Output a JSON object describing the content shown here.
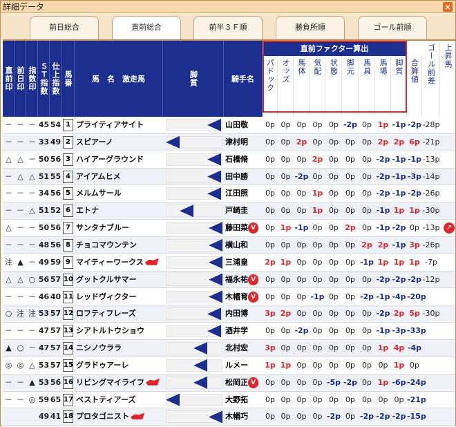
{
  "window": {
    "title": "詳細データ",
    "close_label": "×"
  },
  "tabs": [
    {
      "label": "前日総合",
      "active": false
    },
    {
      "label": "直前総合",
      "active": true
    },
    {
      "label": "前半３Ｆ順",
      "active": false
    },
    {
      "label": "勝負所順",
      "active": false
    },
    {
      "label": "ゴール前順",
      "active": false
    }
  ],
  "columns": {
    "chokuzen": "直前印",
    "zenjitsu": "前日印",
    "shisu": "指数印",
    "st": "ＳＴ指数",
    "shiage": "仕上指数",
    "umaban": "馬番",
    "horse": "馬　名　激走馬",
    "kyakushitsu": "脚質",
    "jockey": "騎手名",
    "factor_title": "直前ファクター算出",
    "factors": [
      "パドック",
      "オッズ",
      "馬体",
      "気配",
      "状態",
      "脚元",
      "馬具",
      "馬場",
      "脚質"
    ],
    "gosan": "合算値",
    "goal": "ゴール前差",
    "rise": "上昇馬"
  },
  "colors": {
    "header": "#1c2e8e",
    "accent": "#e0262c",
    "tab_bg": "#f5e4c8"
  },
  "rows": [
    {
      "chokuzen": "－",
      "zenjitsu": "－",
      "shisu": "－",
      "st": "45",
      "shiage": "54",
      "umaban": "1",
      "horse": "プライティアサイト",
      "hat": false,
      "leg": 3,
      "jockey": "山田敬",
      "v": false,
      "factors": [
        "0p",
        "0p",
        "0p",
        "0p",
        "0p",
        "-2p",
        "0p",
        "1p",
        "-1p"
      ],
      "gosan": "-2p",
      "goal": "-28p",
      "rise": false
    },
    {
      "chokuzen": "－",
      "zenjitsu": "－",
      "shisu": "－",
      "st": "33",
      "shiage": "49",
      "umaban": "2",
      "horse": "スピアーノ",
      "hat": false,
      "leg": 0,
      "jockey": "津村明",
      "v": false,
      "factors": [
        "0p",
        "0p",
        "2p",
        "0p",
        "0p",
        "0p",
        "0p",
        "2p",
        "2p"
      ],
      "gosan": "6p",
      "goal": "-21p",
      "rise": false
    },
    {
      "chokuzen": "△",
      "zenjitsu": "△",
      "shisu": "－",
      "st": "50",
      "shiage": "56",
      "umaban": "3",
      "horse": "ハイアーグラウンド",
      "hat": false,
      "leg": 3,
      "jockey": "石橋脩",
      "v": false,
      "factors": [
        "0p",
        "0p",
        "0p",
        "2p",
        "0p",
        "0p",
        "0p",
        "-2p",
        "-1p"
      ],
      "gosan": "-1p",
      "goal": "-13p",
      "rise": false
    },
    {
      "chokuzen": "－",
      "zenjitsu": "△",
      "shisu": "△",
      "st": "51",
      "shiage": "55",
      "umaban": "4",
      "horse": "アイアムヒメ",
      "hat": false,
      "leg": 3,
      "jockey": "田中勝",
      "v": false,
      "factors": [
        "0p",
        "0p",
        "-2p",
        "0p",
        "0p",
        "0p",
        "0p",
        "-2p",
        "-1p"
      ],
      "gosan": "-3p",
      "goal": "-14p",
      "rise": false
    },
    {
      "chokuzen": "－",
      "zenjitsu": "－",
      "shisu": "－",
      "st": "34",
      "shiage": "56",
      "umaban": "5",
      "horse": "メルムサール",
      "hat": false,
      "leg": 3,
      "jockey": "江田照",
      "v": false,
      "factors": [
        "0p",
        "0p",
        "0p",
        "1p",
        "0p",
        "0p",
        "0p",
        "-2p",
        "-1p"
      ],
      "gosan": "-2p",
      "goal": "-26p",
      "rise": false
    },
    {
      "chokuzen": "－",
      "zenjitsu": "－",
      "shisu": "△",
      "st": "51",
      "shiage": "52",
      "umaban": "6",
      "horse": "エトナ",
      "hat": false,
      "leg": 1,
      "jockey": "戸崎圭",
      "v": false,
      "factors": [
        "0p",
        "0p",
        "0p",
        "1p",
        "0p",
        "0p",
        "0p",
        "-1p",
        "1p"
      ],
      "gosan": "1p",
      "goal": "-30p",
      "rise": false
    },
    {
      "chokuzen": "△",
      "zenjitsu": "－",
      "shisu": "－",
      "st": "50",
      "shiage": "56",
      "umaban": "7",
      "horse": "サンタナブルー",
      "hat": false,
      "leg": 4,
      "jockey": "藤田菜",
      "v": true,
      "factors": [
        "0p",
        "1p",
        "-1p",
        "0p",
        "0p",
        "2p",
        "0p",
        "-1p",
        "-2p"
      ],
      "gosan": "0p",
      "goal": "-13p",
      "rise": true
    },
    {
      "chokuzen": "－",
      "zenjitsu": "－",
      "shisu": "－",
      "st": "48",
      "shiage": "56",
      "umaban": "8",
      "horse": "チョコマウンテン",
      "hat": false,
      "leg": 4,
      "jockey": "横山和",
      "v": false,
      "factors": [
        "0p",
        "0p",
        "0p",
        "0p",
        "0p",
        "0p",
        "2p",
        "2p",
        "-1p"
      ],
      "gosan": "3p",
      "goal": "-26p",
      "rise": false
    },
    {
      "chokuzen": "注",
      "zenjitsu": "▲",
      "shisu": "－",
      "st": "49",
      "shiage": "59",
      "umaban": "9",
      "horse": "マイティーワークス",
      "hat": true,
      "leg": 4,
      "jockey": "三浦皇",
      "v": false,
      "factors": [
        "2p",
        "1p",
        "0p",
        "0p",
        "0p",
        "0p",
        "-1p",
        "1p",
        "1p"
      ],
      "gosan": "1p",
      "goal": "-7p",
      "rise": false
    },
    {
      "chokuzen": "△",
      "zenjitsu": "△",
      "shisu": "○",
      "st": "56",
      "shiage": "57",
      "umaban": "10",
      "horse": "グットクルサマー",
      "hat": false,
      "leg": 4,
      "jockey": "福永祐",
      "v": true,
      "factors": [
        "0p",
        "0p",
        "0p",
        "0p",
        "0p",
        "0p",
        "0p",
        "-2p",
        "-2p"
      ],
      "gosan": "-2p",
      "goal": "-12p",
      "rise": false
    },
    {
      "chokuzen": "－",
      "zenjitsu": "－",
      "shisu": "－",
      "st": "46",
      "shiage": "40",
      "umaban": "11",
      "horse": "レッドヴィクター",
      "hat": false,
      "leg": 4,
      "jockey": "木幡育",
      "v": true,
      "factors": [
        "0p",
        "0p",
        "0p",
        "-1p",
        "0p",
        "0p",
        "-2p",
        "-1p",
        "-4p"
      ],
      "gosan": "-20p",
      "goal": "",
      "rise": false
    },
    {
      "chokuzen": "○",
      "zenjitsu": "注",
      "shisu": "注",
      "st": "53",
      "shiage": "57",
      "umaban": "12",
      "horse": "ロフティフレーズ",
      "hat": false,
      "leg": 3,
      "jockey": "内田博",
      "v": false,
      "factors": [
        "3p",
        "2p",
        "0p",
        "0p",
        "0p",
        "0p",
        "0p",
        "-2p",
        "2p"
      ],
      "gosan": "5p",
      "goal": "-30p",
      "rise": false
    },
    {
      "chokuzen": "－",
      "zenjitsu": "－",
      "shisu": "－",
      "st": "47",
      "shiage": "57",
      "umaban": "13",
      "horse": "シアトルトウショウ",
      "hat": false,
      "leg": 3,
      "jockey": "酒井学",
      "v": false,
      "factors": [
        "0p",
        "0p",
        "-2p",
        "0p",
        "0p",
        "0p",
        "0p",
        "-1p",
        "-3p"
      ],
      "gosan": "-33p",
      "goal": "",
      "rise": false
    },
    {
      "chokuzen": "▲",
      "zenjitsu": "○",
      "shisu": "－",
      "st": "47",
      "shiage": "57",
      "umaban": "14",
      "horse": "ニシノウララ",
      "hat": false,
      "leg": 2,
      "jockey": "北村宏",
      "v": false,
      "factors": [
        "3p",
        "0p",
        "0p",
        "0p",
        "0p",
        "0p",
        "0p",
        "1p",
        "4p"
      ],
      "gosan": "-4p",
      "goal": "",
      "rise": false
    },
    {
      "chokuzen": "◎",
      "zenjitsu": "◎",
      "shisu": "△",
      "st": "53",
      "shiage": "57",
      "umaban": "15",
      "horse": "グラドゥアーレ",
      "hat": false,
      "leg": 2,
      "jockey": "ルメー",
      "v": false,
      "factors": [
        "1p",
        "1p",
        "0p",
        "0p",
        "0p",
        "0p",
        "0p",
        "0p",
        "1p"
      ],
      "gosan": "0p",
      "goal": "",
      "rise": false
    },
    {
      "chokuzen": "－",
      "zenjitsu": "－",
      "shisu": "▲",
      "st": "53",
      "shiage": "56",
      "umaban": "16",
      "horse": "リビングマイライフ",
      "hat": true,
      "leg": 2,
      "jockey": "松岡正",
      "v": true,
      "factors": [
        "0p",
        "0p",
        "0p",
        "0p",
        "-5p",
        "-2p",
        "0p",
        "1p",
        "-6p"
      ],
      "gosan": "-24p",
      "goal": "",
      "rise": false
    },
    {
      "chokuzen": "－",
      "zenjitsu": "－",
      "shisu": "◎",
      "st": "59",
      "shiage": "65",
      "umaban": "17",
      "horse": "ベストティアーズ",
      "hat": false,
      "leg": 0,
      "jockey": "大野拓",
      "v": false,
      "factors": [
        "0p",
        "0p",
        "0p",
        "0p",
        "0p",
        "0p",
        "0p",
        "0p",
        "0p"
      ],
      "gosan": "-21p",
      "goal": "",
      "rise": false
    },
    {
      "chokuzen": "",
      "zenjitsu": "",
      "shisu": "",
      "st": "49",
      "shiage": "41",
      "umaban": "18",
      "horse": "プロタゴニスト",
      "hat": true,
      "leg": 4,
      "jockey": "木幡巧",
      "v": false,
      "factors": [
        "0p",
        "0p",
        "0p",
        "0p",
        "-2p",
        "0p",
        "-2p",
        "-2p",
        "-2p"
      ],
      "gosan": "-15p",
      "goal": "",
      "rise": false
    }
  ]
}
